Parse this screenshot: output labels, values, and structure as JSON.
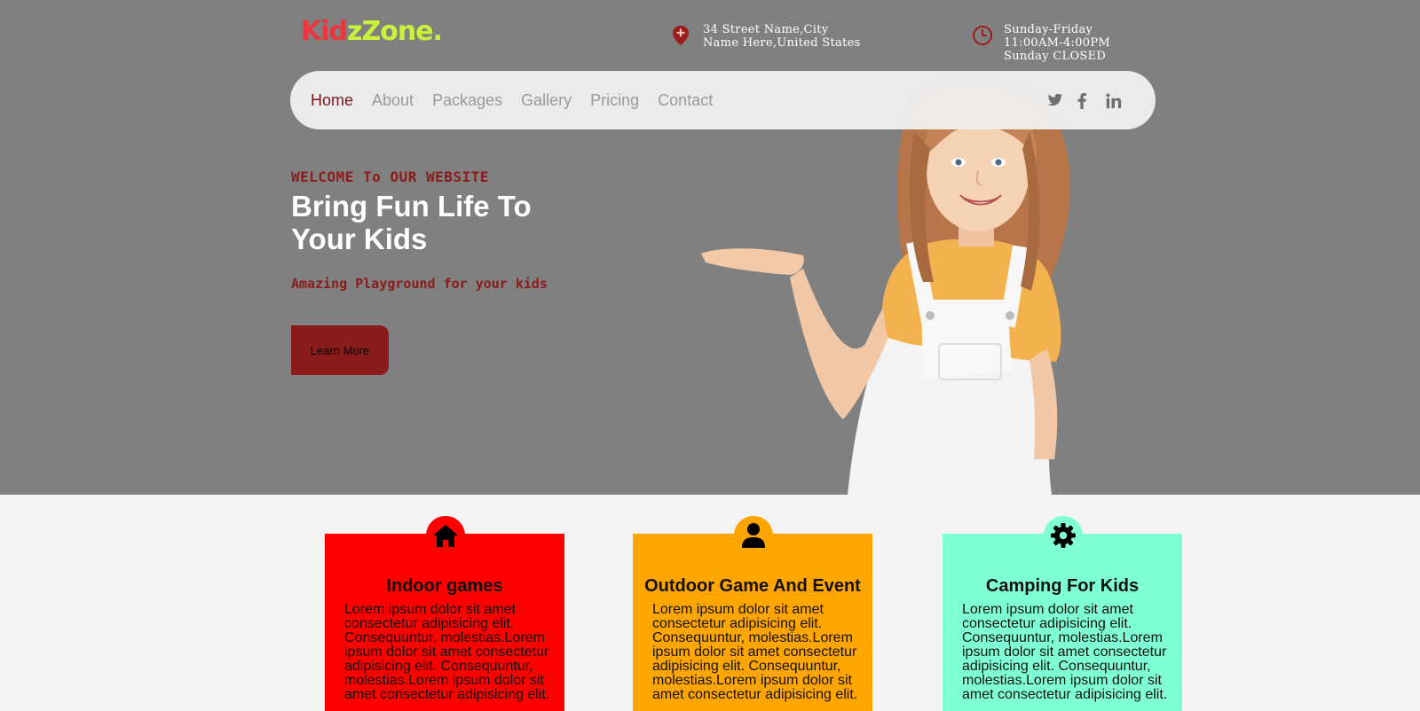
{
  "logo": {
    "part1": "Kid",
    "part2": "zZone."
  },
  "contact": {
    "address": "34 Street Name,City Name Here,United States",
    "hours": "Sunday-Friday 11:00AM-4:00PM Sunday CLOSED"
  },
  "nav": {
    "items": [
      "Home",
      "About",
      "Packages",
      "Gallery",
      "Pricing",
      "Contact"
    ],
    "active": "Home",
    "social": [
      "twitter-icon",
      "facebook-icon",
      "linkedin-icon"
    ]
  },
  "hero": {
    "welcome": "WELCOME To OUR WEBSITE",
    "headline": "Bring Fun Life To Your Kids",
    "subline": "Amazing Playground for your kids",
    "cta": "Learn More"
  },
  "services": [
    {
      "title": "Indoor games",
      "icon": "home-icon",
      "color": "#ff0000",
      "text": "Lorem ipsum dolor sit amet consectetur adipisicing elit. Consequuntur, molestias.Lorem ipsum dolor sit amet consectetur adipisicing elit. Consequuntur, molestias.Lorem ipsum dolor sit amet consectetur adipisicing elit."
    },
    {
      "title": "Outdoor Game And Event",
      "icon": "user-icon",
      "color": "#ffa500",
      "text": "Lorem ipsum dolor sit amet consectetur adipisicing elit. Consequuntur, molestias.Lorem ipsum dolor sit amet consectetur adipisicing elit. Consequuntur, molestias.Lorem ipsum dolor sit amet consectetur adipisicing elit."
    },
    {
      "title": "Camping For Kids",
      "icon": "gear-icon",
      "color": "#7fffd4",
      "text": "Lorem ipsum dolor sit amet consectetur adipisicing elit. Consequuntur, molestias.Lorem ipsum dolor sit amet consectetur adipisicing elit. Consequuntur, molestias.Lorem ipsum dolor sit amet consectetur adipisicing elit."
    }
  ],
  "colors": {
    "hero_bg": "#808080",
    "accent": "#8a1c1c",
    "logo_red": "#e8383d",
    "logo_green": "#c9f23c"
  }
}
